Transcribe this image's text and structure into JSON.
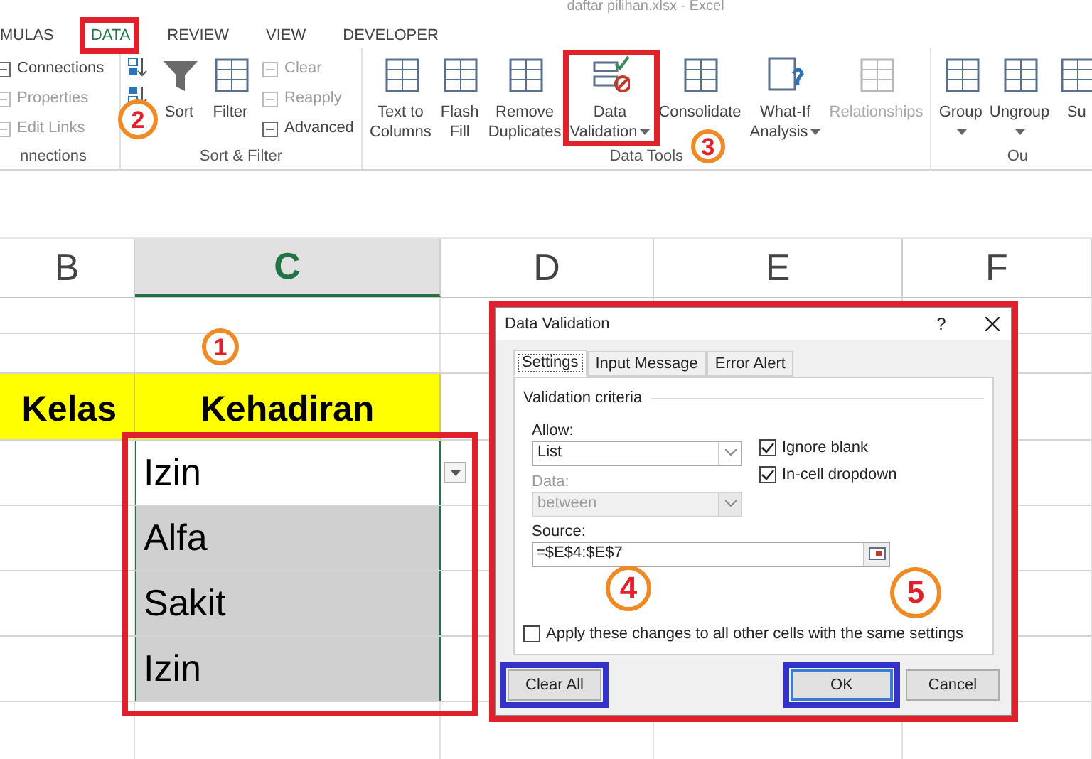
{
  "window": {
    "title": "daftar pilihan.xlsx - Excel"
  },
  "ribbon_tabs": [
    {
      "label": "MULAS",
      "selected": false
    },
    {
      "label": "DATA",
      "selected": true
    },
    {
      "label": "REVIEW",
      "selected": false
    },
    {
      "label": "VIEW",
      "selected": false
    },
    {
      "label": "DEVELOPER",
      "selected": false
    }
  ],
  "ribbon_groups": [
    {
      "label": "nnections",
      "items": [
        {
          "kind": "stack",
          "entries": [
            {
              "label": "Connections",
              "disabled": false
            },
            {
              "label": "Properties",
              "disabled": true
            },
            {
              "label": "Edit Links",
              "disabled": true
            }
          ]
        }
      ]
    },
    {
      "label": "Sort & Filter",
      "items": [
        {
          "kind": "sort-pair"
        },
        {
          "kind": "large",
          "lines": [
            "Sort"
          ],
          "dropdown": false,
          "disabled": false
        },
        {
          "kind": "large",
          "lines": [
            "Filter"
          ],
          "dropdown": false,
          "disabled": false
        },
        {
          "kind": "stack",
          "entries": [
            {
              "label": "Clear",
              "disabled": true
            },
            {
              "label": "Reapply",
              "disabled": true
            },
            {
              "label": "Advanced",
              "disabled": false
            }
          ]
        }
      ]
    },
    {
      "label": "Data Tools",
      "items": [
        {
          "kind": "large",
          "lines": [
            "Text to",
            "Columns"
          ],
          "dropdown": false,
          "disabled": false
        },
        {
          "kind": "large",
          "lines": [
            "Flash",
            "Fill"
          ],
          "dropdown": false,
          "disabled": false
        },
        {
          "kind": "large",
          "lines": [
            "Remove",
            "Duplicates"
          ],
          "dropdown": false,
          "disabled": false
        },
        {
          "kind": "large",
          "lines": [
            "Data",
            "Validation"
          ],
          "dropdown": true,
          "disabled": false
        },
        {
          "kind": "large",
          "lines": [
            "Consolidate"
          ],
          "dropdown": false,
          "disabled": false
        },
        {
          "kind": "large",
          "lines": [
            "What-If",
            "Analysis"
          ],
          "dropdown": true,
          "disabled": false
        },
        {
          "kind": "large",
          "lines": [
            "Relationships"
          ],
          "dropdown": false,
          "disabled": true
        }
      ]
    },
    {
      "label": "Ou",
      "items": [
        {
          "kind": "large",
          "lines": [
            "Group"
          ],
          "dropdown": true,
          "disabled": false
        },
        {
          "kind": "large",
          "lines": [
            "Ungroup"
          ],
          "dropdown": true,
          "disabled": false
        },
        {
          "kind": "large",
          "lines": [
            "Su"
          ],
          "dropdown": false,
          "disabled": false
        }
      ]
    }
  ],
  "sheet": {
    "columns": [
      {
        "label": "B",
        "selected": false
      },
      {
        "label": "C",
        "selected": true
      },
      {
        "label": "D",
        "selected": false
      },
      {
        "label": "E",
        "selected": false
      },
      {
        "label": "F",
        "selected": false
      }
    ],
    "rows": [
      {
        "kind": "blank"
      },
      {
        "kind": "blank"
      },
      {
        "kind": "header",
        "cells": [
          "Kelas",
          "Kehadiran"
        ]
      },
      {
        "kind": "data",
        "value": "Izin",
        "highlighted": false,
        "dropdown": true
      },
      {
        "kind": "data",
        "value": "Alfa",
        "highlighted": true,
        "dropdown": false
      },
      {
        "kind": "data",
        "value": "Sakit",
        "highlighted": true,
        "dropdown": false
      },
      {
        "kind": "data",
        "value": "Izin",
        "highlighted": true,
        "dropdown": false
      },
      {
        "kind": "blank"
      }
    ]
  },
  "dialog": {
    "title": "Data Validation",
    "help": "?",
    "tabs": [
      {
        "label": "Settings",
        "selected": true
      },
      {
        "label": "Input Message",
        "selected": false
      },
      {
        "label": "Error Alert",
        "selected": false
      }
    ],
    "section": "Validation criteria",
    "allow": {
      "label": "Allow:",
      "value": "List",
      "disabled": false
    },
    "data": {
      "label": "Data:",
      "value": "between",
      "disabled": true
    },
    "checkboxes": [
      {
        "label": "Ignore blank",
        "checked": true
      },
      {
        "label": "In-cell dropdown",
        "checked": true
      }
    ],
    "source": {
      "label": "Source:",
      "value": "=$E$4:$E$7"
    },
    "apply": {
      "label": "Apply these changes to all other cells with the same settings",
      "checked": false
    },
    "buttons": [
      {
        "label": "Clear All",
        "default": false
      },
      {
        "label": "OK",
        "default": true
      },
      {
        "label": "Cancel",
        "default": false
      }
    ]
  },
  "annotations": {
    "markers": [
      {
        "label": "1"
      },
      {
        "label": "2"
      },
      {
        "label": "3"
      },
      {
        "label": "4"
      },
      {
        "label": "5"
      }
    ],
    "frames": [
      {
        "color": "#e0202a"
      },
      {
        "color": "#e0202a"
      },
      {
        "color": "#e0202a"
      },
      {
        "color": "#e0202a"
      },
      {
        "color": "#3333cc"
      },
      {
        "color": "#3333cc"
      }
    ]
  }
}
